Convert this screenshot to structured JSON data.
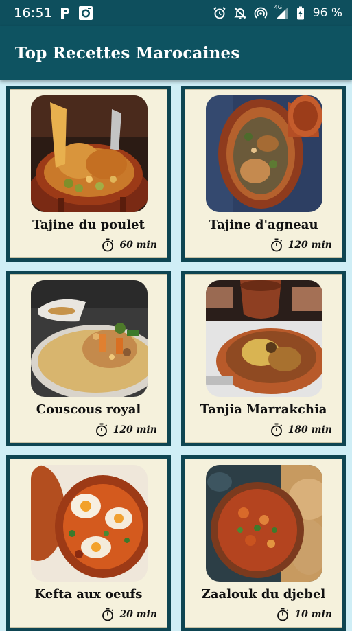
{
  "status_bar": {
    "time": "16:51",
    "left_icons": [
      "parking-p-icon",
      "camera-icon"
    ],
    "right_icons": [
      "alarm-icon",
      "notifications-off-icon",
      "hotspot-icon",
      "signal-4g-icon",
      "battery-icon"
    ],
    "network_label": "4G",
    "battery_percent": "96 %"
  },
  "app_bar": {
    "title": "Top Recettes Marocaines"
  },
  "recipes": [
    {
      "name": "Tajine du poulet",
      "time": "60 min",
      "image": "chicken-tagine"
    },
    {
      "name": "Tajine d'agneau",
      "time": "120 min",
      "image": "lamb-tagine"
    },
    {
      "name": "Couscous royal",
      "time": "120 min",
      "image": "couscous"
    },
    {
      "name": "Tanjia Marrakchia",
      "time": "180 min",
      "image": "tanjia"
    },
    {
      "name": "Kefta aux oeufs",
      "time": "20 min",
      "image": "kefta-eggs"
    },
    {
      "name": "Zaalouk du djebel",
      "time": "10 min",
      "image": "zaalouk"
    }
  ],
  "colors": {
    "app_bar": "#0e5361",
    "status_bar": "#0e4f5d",
    "page_background": "#cfeef6",
    "card_frame": "#0e4552",
    "card_surface": "#f5f1dc"
  }
}
